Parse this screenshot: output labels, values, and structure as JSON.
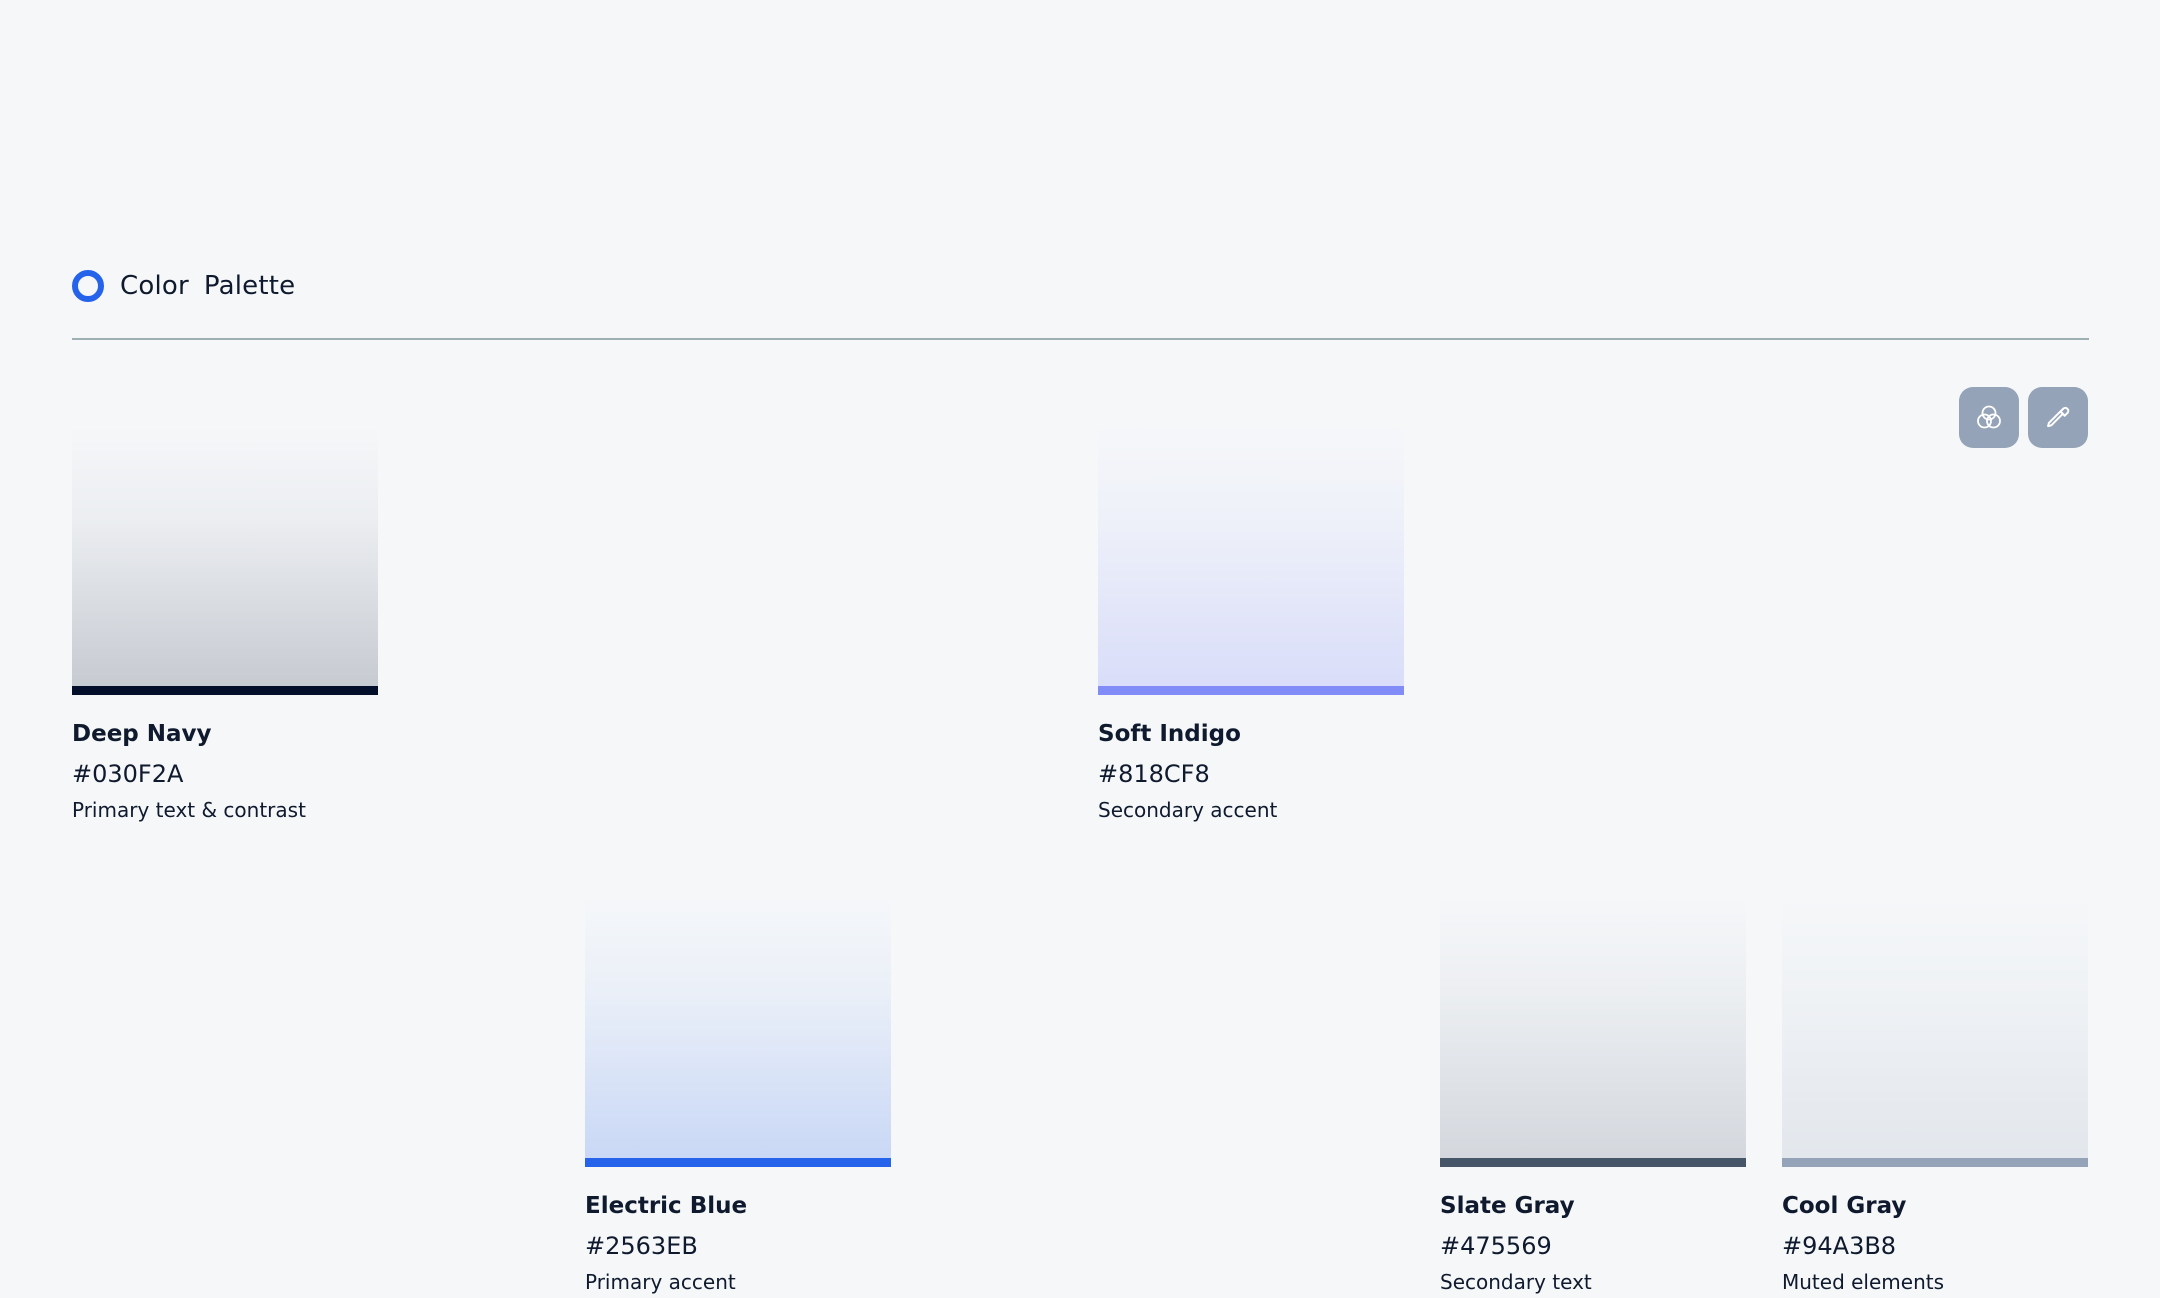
{
  "header": {
    "title_word_1": "Color",
    "title_word_2": "Palette"
  },
  "toolbar": {
    "blend_button": {
      "icon": "color-blend-icon"
    },
    "picker_button": {
      "icon": "eyedropper-icon"
    }
  },
  "colors": {
    "accent": "#2563EB",
    "button_bg": "#94A3B8",
    "background": "#F5F7F9"
  },
  "swatches": [
    {
      "name": "Deep Navy",
      "hex": "#030F2A",
      "description": "Primary text & contrast",
      "color": "#030F2A"
    },
    {
      "name": "Soft Indigo",
      "hex": "#818CF8",
      "description": "Secondary accent",
      "color": "#818CF8"
    },
    {
      "name": "Electric Blue",
      "hex": "#2563EB",
      "description": "Primary accent",
      "color": "#2563EB"
    },
    {
      "name": "Slate Gray",
      "hex": "#475569",
      "description": "Secondary text",
      "color": "#475569"
    },
    {
      "name": "Cool Gray",
      "hex": "#94A3B8",
      "description": "Muted elements",
      "color": "#94A3B8"
    }
  ]
}
